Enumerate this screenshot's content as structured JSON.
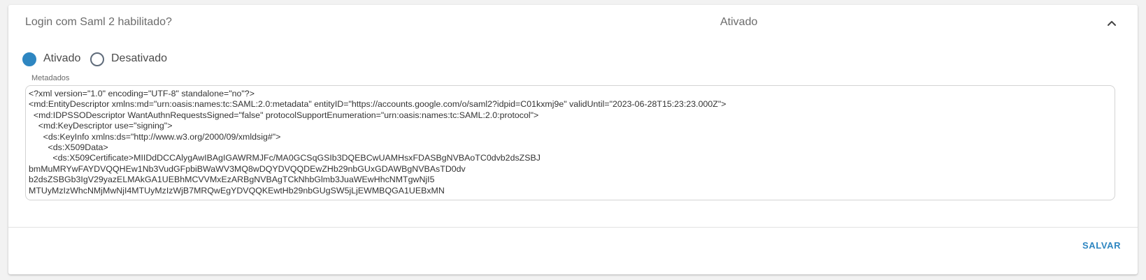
{
  "panel": {
    "title": "Login com Saml 2 habilitado?",
    "status": "Ativado",
    "chevron_icon": "chevron-up-icon",
    "expanded": true
  },
  "radio": {
    "options": [
      {
        "label": "Ativado",
        "checked": true
      },
      {
        "label": "Desativado",
        "checked": false
      }
    ]
  },
  "metadata_field": {
    "label": "Metadados",
    "value": "<?xml version=\"1.0\" encoding=\"UTF-8\" standalone=\"no\"?>\n<md:EntityDescriptor xmlns:md=\"urn:oasis:names:tc:SAML:2.0:metadata\" entityID=\"https://accounts.google.com/o/saml2?idpid=C01kxmj9e\" validUntil=\"2023-06-28T15:23:23.000Z\">\n  <md:IDPSSODescriptor WantAuthnRequestsSigned=\"false\" protocolSupportEnumeration=\"urn:oasis:names:tc:SAML:2.0:protocol\">\n    <md:KeyDescriptor use=\"signing\">\n      <ds:KeyInfo xmlns:ds=\"http://www.w3.org/2000/09/xmldsig#\">\n        <ds:X509Data>\n          <ds:X509Certificate>MIIDdDCCAlygAwIBAgIGAWRMJFc/MA0GCSqGSIb3DQEBCwUAMHsxFDASBgNVBAoTC0dvb2dsZSBJ\nbmMuMRYwFAYDVQQHEw1Nb3VudGFpbiBWaWV3MQ8wDQYDVQQDEwZHb29nbGUxGDAWBgNVBAsTD0dv\nb2dsZSBGb3IgV29yazELMAkGA1UEBhMCVVMxEzARBgNVBAgTCkNhbGlmb3JuaWEwHhcNMTgwNjI5\nMTUyMzIzWhcNMjMwNjI4MTUyMzIzWjB7MRQwEgYDVQQKEwtHb29nbGUgSW5jLjEWMBQGA1UEBxMN"
  },
  "actions": {
    "save_label": "SALVAR"
  },
  "colors": {
    "accent": "#2e86c1",
    "text_muted": "#6b6b6b"
  }
}
